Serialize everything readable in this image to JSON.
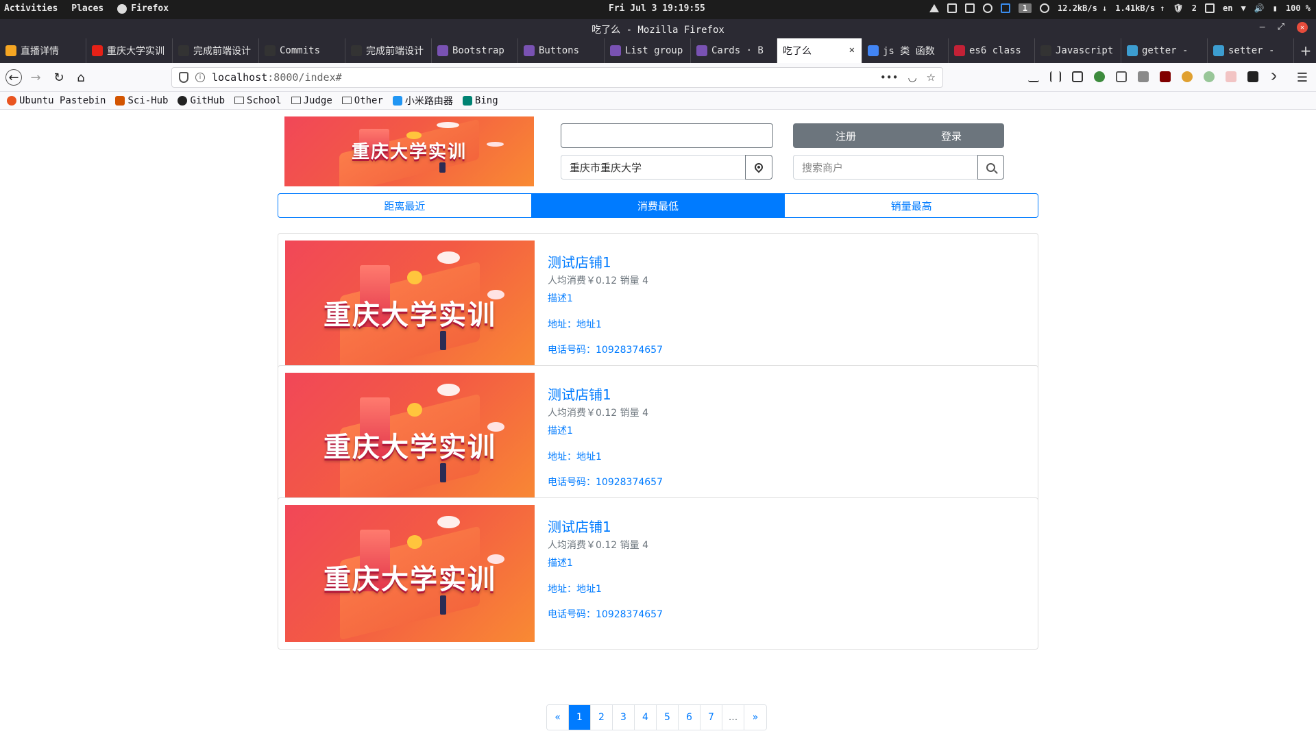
{
  "system_bar": {
    "activities": "Activities",
    "places": "Places",
    "app": "Firefox",
    "clock": "Fri Jul 3 19:19:55",
    "workspace": "1",
    "net_down": "12.2kB/s ↓",
    "net_up": "1.41kB/s ↑",
    "shield_count": "2",
    "lang": "en",
    "battery": "100 %"
  },
  "window": {
    "title": "吃了么 - Mozilla Firefox"
  },
  "tabs": [
    {
      "label": "直播详情",
      "icon": "bilibili-live-icon",
      "color": "#f5a623"
    },
    {
      "label": "重庆大学实训",
      "icon": "youtube-icon",
      "color": "#e62117"
    },
    {
      "label": "完成前端设计",
      "icon": "github-icon",
      "color": "#333333"
    },
    {
      "label": "Commits",
      "icon": "github-icon",
      "color": "#333333"
    },
    {
      "label": "完成前端设计",
      "icon": "github-icon",
      "color": "#333333"
    },
    {
      "label": "Bootstrap",
      "icon": "bootstrap-icon",
      "color": "#7952b3"
    },
    {
      "label": "Buttons",
      "icon": "bootstrap-icon",
      "color": "#7952b3"
    },
    {
      "label": "List group",
      "icon": "bootstrap-icon",
      "color": "#7952b3"
    },
    {
      "label": "Cards · B",
      "icon": "bootstrap-icon",
      "color": "#7952b3"
    },
    {
      "label": "吃了么",
      "icon": "",
      "color": "",
      "active": true
    },
    {
      "label": "js 类 函数",
      "icon": "google-icon",
      "color": "#4285f4"
    },
    {
      "label": "es6 class",
      "icon": "csdn-icon",
      "color": "#c32136"
    },
    {
      "label": "Javascript",
      "icon": "document-icon",
      "color": "#333333"
    },
    {
      "label": "getter -",
      "icon": "mdn-icon",
      "color": "#3c9dd0"
    },
    {
      "label": "setter -",
      "icon": "mdn-icon",
      "color": "#3c9dd0"
    }
  ],
  "url": {
    "host": "localhost",
    "rest": ":8000/index#"
  },
  "bookmarks": [
    {
      "label": "Ubuntu Pastebin",
      "icon": "ubuntu-icon",
      "color": "#e95420"
    },
    {
      "label": "Sci-Hub",
      "icon": "scihub-icon",
      "color": "#d35400"
    },
    {
      "label": "GitHub",
      "icon": "github-icon",
      "color": "#222222"
    },
    {
      "label": "School",
      "icon": "folder-icon",
      "color": ""
    },
    {
      "label": "Judge",
      "icon": "folder-icon",
      "color": ""
    },
    {
      "label": "Other",
      "icon": "folder-icon",
      "color": ""
    },
    {
      "label": "小米路由器",
      "icon": "wifi-icon",
      "color": "#2196f3"
    },
    {
      "label": "Bing",
      "icon": "bing-icon",
      "color": "#008373"
    }
  ],
  "header": {
    "logo_text": "重庆大学实训",
    "username_value": "",
    "location_value": "重庆市重庆大学",
    "register_label": "注册",
    "login_label": "登录",
    "search_placeholder": "搜索商户"
  },
  "sort_options": [
    {
      "label": "距离最近",
      "active": false
    },
    {
      "label": "消费最低",
      "active": true
    },
    {
      "label": "销量最高",
      "active": false
    }
  ],
  "shops": [
    {
      "banner_text": "重庆大学实训",
      "name": "测试店铺1",
      "stats": "人均消费￥0.12 销量 4",
      "description": "描述1",
      "address": "地址：地址1",
      "phone": "电话号码：10928374657"
    },
    {
      "banner_text": "重庆大学实训",
      "name": "测试店铺1",
      "stats": "人均消费￥0.12 销量 4",
      "description": "描述1",
      "address": "地址：地址1",
      "phone": "电话号码：10928374657"
    },
    {
      "banner_text": "重庆大学实训",
      "name": "测试店铺1",
      "stats": "人均消费￥0.12 销量 4",
      "description": "描述1",
      "address": "地址：地址1",
      "phone": "电话号码：10928374657"
    }
  ],
  "pagination": {
    "prev": "«",
    "pages": [
      "1",
      "2",
      "3",
      "4",
      "5",
      "6",
      "7"
    ],
    "active_page": "1",
    "ellipsis": "...",
    "next": "»"
  },
  "colors": {
    "primary": "#007bff",
    "secondary": "#6c757d",
    "banner_red": "#f14758",
    "banner_orange": "#f98a33"
  }
}
